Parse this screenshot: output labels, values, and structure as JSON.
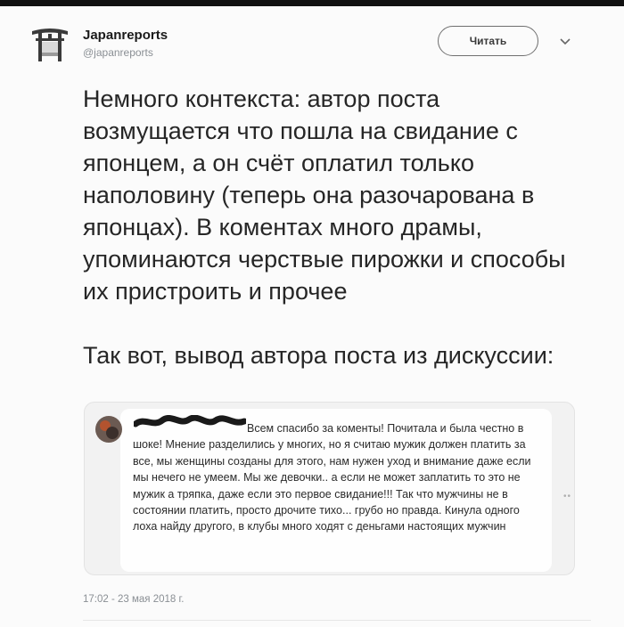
{
  "account": {
    "name": "Japanreports",
    "handle": "@japanreports"
  },
  "follow_button": {
    "label": "Читать"
  },
  "tweet": {
    "paragraph1": "Немного контекста: автор поста возмущается что пошла на свидание с японцем, а он счёт оплатил только наполовину (теперь она разочарована в японцах). В коментах много драмы, упоминаются черствые пирожки и способы их пристроить и прочее",
    "paragraph2": "Так вот, вывод автора поста из дискуссии:"
  },
  "quoted_comment": {
    "text": "Всем спасибо за коменты! Почитала и была честно в шоке! Мнение разделились у многих, но я считаю мужик должен платить за все, мы женщины созданы для этого, нам нужен уход и внимание даже если мы нечего не умеем. Мы же девочки.. а если не может заплатить то это не мужик а тряпка, даже если это первое свидание!!! Так что мужчины не в состоянии платить, просто дрочите тихо... грубо но правда. Кинула одного лоха найду другого, в клубы много ходят с деньгами настоящих мужчин"
  },
  "timestamp": "17:02 - 23 мая 2018 г.",
  "icons": {
    "avatar": "torii-gate-icon",
    "menu": "chevron-down-icon"
  }
}
